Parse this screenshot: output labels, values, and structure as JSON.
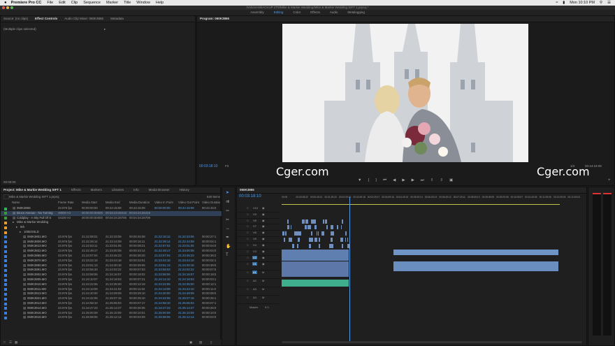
{
  "menubar": {
    "app": "Premiere Pro CC",
    "items": [
      "File",
      "Edit",
      "Clip",
      "Sequence",
      "Marker",
      "Title",
      "Window",
      "Help"
    ],
    "clock": "Mon 10:10 PM"
  },
  "window": {
    "title": "/Volumes/BACKUP 2T8/Mike & Markie Wedding/Mike & Markie Wedding SIFT 1.prproj *"
  },
  "workspaces": [
    "Assembly",
    "Editing",
    "Color",
    "Effects",
    "Audio",
    "Metalogging"
  ],
  "active_workspace": "Editing",
  "source_panel": {
    "tabs": [
      "Source: (no clips)",
      "Effect Controls",
      "Audio Clip Mixer: 060K3865",
      "Metadata"
    ],
    "active_tab": "Effect Controls",
    "message": "(Multiple clips selected)",
    "timecode": "00:00:00"
  },
  "program_panel": {
    "tab": "Program: 060K3865",
    "timecode": "00:03:18:10",
    "fit": "Fit",
    "duration": "00:44:18:08",
    "quality": "1/4"
  },
  "project_panel": {
    "tabs": [
      "Project: Mike & Markie Wedding SIFT 1",
      "Effects",
      "Markers",
      "Libraries",
      "Info",
      "Media Browser",
      "History"
    ],
    "active_tab": "Project: Mike & Markie Wedding SIFT 1",
    "path": "Mike & Markie Wedding SIFT 1.prproj",
    "item_count": "540 Items",
    "columns": [
      "Name",
      "Frame Rate",
      "Media Start",
      "Media End",
      "Media Duration",
      "Video In Point",
      "Video Out Point",
      "Video Duratio"
    ],
    "rows": [
      {
        "name": "060K3865",
        "fr": "23.976 fps",
        "ms": "00:00:00:00",
        "me": "00:44:15:08",
        "md": "00:44:15:09",
        "vi": "00:00:00:00",
        "vo": "00:44:15:08",
        "vd": "00:44:15:0",
        "color": "#2db55d",
        "indent": 1
      },
      {
        "name": "Bruce Avenue - No Turning",
        "fr": "48000 Hz",
        "ms": "00:00:00:00000",
        "me": "00:03:23:28418",
        "md": "00:03:23:28419",
        "vi": "",
        "vo": "",
        "vd": "",
        "color": "#3b9b3b",
        "indent": 1
      },
      {
        "name": "Coldplay - A Sky Full Of S",
        "fr": "44100 Hz",
        "ms": "00:00:00:00000",
        "me": "00:04:34:28708",
        "md": "00:04:34:28709",
        "vi": "",
        "vo": "",
        "vd": "",
        "color": "#3b9b3b",
        "indent": 1
      },
      {
        "name": "Mike & Markie Wedding",
        "fr": "",
        "ms": "",
        "me": "",
        "md": "",
        "vi": "",
        "vo": "",
        "vd": "",
        "color": "#e89a2c",
        "indent": 1
      },
      {
        "name": "5th",
        "fr": "",
        "ms": "",
        "me": "",
        "md": "",
        "vi": "",
        "vo": "",
        "vd": "",
        "color": "#e89a2c",
        "indent": 2
      },
      {
        "name": "100EOSLD",
        "fr": "",
        "ms": "",
        "me": "",
        "md": "",
        "vi": "",
        "vo": "",
        "vd": "",
        "color": "#e89a2c",
        "indent": 3
      },
      {
        "name": "060K3801.MO",
        "fr": "23.976 fps",
        "ms": "21:22:08:01",
        "me": "21:22:33:08",
        "md": "00:00:45:08",
        "vi": "21:22:15:12",
        "vo": "21:22:33:06",
        "vd": "00:00:27:1",
        "color": "#3d7ed8",
        "indent": 4
      },
      {
        "name": "060K3808.MO",
        "fr": "23.976 fps",
        "ms": "21:22:28:14",
        "me": "21:22:44:09",
        "md": "00:00:16:11",
        "vi": "21:22:39:14",
        "vo": "21:22:44:09",
        "vd": "00:00:04:1",
        "color": "#3d7ed8",
        "indent": 4
      },
      {
        "name": "060K3813.MO",
        "fr": "23.976 fps",
        "ms": "21:22:53:11",
        "me": "21:23:01:05",
        "md": "00:00:08:21",
        "vi": "21:22:57:02",
        "vo": "21:23:01:05",
        "vd": "00:00:04:0",
        "color": "#3d7ed8",
        "indent": 4
      },
      {
        "name": "060K3822.MO",
        "fr": "23.976 fps",
        "ms": "21:22:49:17",
        "me": "21:23:00:08",
        "md": "00:00:43:14",
        "vi": "21:22:49:17",
        "vo": "21:23:00:08",
        "vd": "00:00:04:0",
        "color": "#3d7ed8",
        "indent": 4
      },
      {
        "name": "060K3865.MO",
        "fr": "23.976 fps",
        "ms": "21:23:07:04",
        "me": "21:23:45:23",
        "md": "00:00:38:20",
        "vi": "21:23:07:04",
        "vo": "21:23:45:23",
        "vd": "00:00:38:2",
        "color": "#3d7ed8",
        "indent": 4
      },
      {
        "name": "060K3870.MO",
        "fr": "23.976 fps",
        "ms": "21:23:22:18",
        "me": "21:23:44:18",
        "md": "00:00:22:01",
        "vi": "21:23:44:18",
        "vo": "21:23:44:10",
        "vd": "00:00:02:1",
        "color": "#3d7ed8",
        "indent": 4
      },
      {
        "name": "060K3880.MO",
        "fr": "23.976 fps",
        "ms": "21:23:51:13",
        "me": "21:24:30:18",
        "md": "00:00:39:06",
        "vi": "21:23:51:13",
        "vo": "21:24:30:18",
        "vd": "00:00:39:0",
        "color": "#3d7ed8",
        "indent": 4
      },
      {
        "name": "060K3891.MO",
        "fr": "23.976 fps",
        "ms": "21:23:55:33",
        "me": "21:24:02:22",
        "md": "00:00:07:03",
        "vi": "21:23:55:03",
        "vo": "21:24:02:22",
        "vd": "00:00:07:0",
        "color": "#3d7ed8",
        "indent": 4
      },
      {
        "name": "060K3902.MO",
        "fr": "23.976 fps",
        "ms": "21:23:58:06",
        "me": "21:24:16:07",
        "md": "00:00:18:02",
        "vi": "21:23:58:06",
        "vo": "21:24:16:07",
        "vd": "00:00:18:0",
        "color": "#3d7ed8",
        "indent": 4
      },
      {
        "name": "060K3905.MO",
        "fr": "23.976 fps",
        "ms": "21:24:10:07",
        "me": "21:24:18:03",
        "md": "00:00:07:21",
        "vi": "21:24:14:10",
        "vo": "21:24:18:03",
        "vd": "00:00:03:1",
        "color": "#3d7ed8",
        "indent": 4
      },
      {
        "name": "060K3910.MO",
        "fr": "23.976 fps",
        "ms": "21:24:22:06",
        "me": "21:24:35:00",
        "md": "00:00:12:19",
        "vi": "21:24:22:06",
        "vo": "21:24:35:00",
        "vd": "00:00:12:1",
        "color": "#3d7ed8",
        "indent": 4
      },
      {
        "name": "060K3911.MO",
        "fr": "23.976 fps",
        "ms": "21:24:13:09",
        "me": "21:24:41:02",
        "md": "00:00:11:02",
        "vi": "21:24:13:09",
        "vo": "21:24:24:10",
        "vd": "00:00:11:0",
        "color": "#3d7ed8",
        "indent": 4
      },
      {
        "name": "060K3913.MO",
        "fr": "23.976 fps",
        "ms": "21:24:40:00",
        "me": "21:24:09:09",
        "md": "00:00:29:10",
        "vi": "21:24:40:00",
        "vo": "21:24:48:09",
        "vd": "00:00:08:0",
        "color": "#3d7ed8",
        "indent": 4
      },
      {
        "name": "060K3921.MO",
        "fr": "23.976 fps",
        "ms": "21:24:42:06",
        "me": "21:25:07:15",
        "md": "00:00:25:10",
        "vi": "21:24:42:06",
        "vo": "21:25:07:15",
        "vd": "00:00:25:1",
        "color": "#3d7ed8",
        "indent": 4
      },
      {
        "name": "060K3913.MO",
        "fr": "23.976 fps",
        "ms": "21:24:58:10",
        "me": "21:25:05:03",
        "md": "00:00:07:17",
        "vi": "21:24:58:10",
        "vo": "21:25:05:03",
        "vd": "00:00:07:1",
        "color": "#3d7ed8",
        "indent": 4
      },
      {
        "name": "060K3914.MO",
        "fr": "23.976 fps",
        "ms": "21:24:47:23",
        "me": "21:25:14:27",
        "md": "00:00:26:05",
        "vi": "21:24:47:23",
        "vo": "21:25:14:27",
        "vd": "00:00:26:0",
        "color": "#3d7ed8",
        "indent": 4
      },
      {
        "name": "060K3915.MO",
        "fr": "23.976 fps",
        "ms": "21:25:00:09",
        "me": "21:25:10:09",
        "md": "00:00:10:01",
        "vi": "21:25:00:09",
        "vo": "21:25:10:09",
        "vd": "00:00:10:0",
        "color": "#3d7ed8",
        "indent": 4
      },
      {
        "name": "060K3916.MO",
        "fr": "23.976 fps",
        "ms": "21:25:08:05",
        "me": "21:25:12:14",
        "md": "00:00:04:09",
        "vi": "21:25:08:05",
        "vo": "21:25:12:14",
        "vd": "00:00:04:0",
        "color": "#3d7ed8",
        "indent": 4
      }
    ]
  },
  "timeline": {
    "tab": "060K3865",
    "timecode": "00:03:18:10",
    "ruler": [
      "00:00",
      "00:00:08:22",
      "00:00:49:21",
      "00:01:29:20",
      "00:02:09:19",
      "00:02:49:18",
      "00:03:29:17",
      "00:04:09:16",
      "00:04:49:15",
      "00:05:29:14",
      "00:06:09:13",
      "00:06:49:12",
      "00:07:29:11",
      "00:08:09:10",
      "00:08:49:09",
      "00:09:29:08",
      "00:10:09:07",
      "00:10:49:06",
      "00:11:29:05",
      "00:12:09:04",
      "00:12:49:03"
    ],
    "video_tracks": [
      "V10",
      "V9",
      "V8",
      "V7",
      "V6",
      "V5",
      "V4",
      "V3",
      "V2",
      "V1"
    ],
    "audio_tracks": [
      "A1",
      "A2",
      "A3",
      "A4"
    ],
    "master": "Master",
    "master_level": "0.0"
  },
  "watermark": "Cger.com"
}
